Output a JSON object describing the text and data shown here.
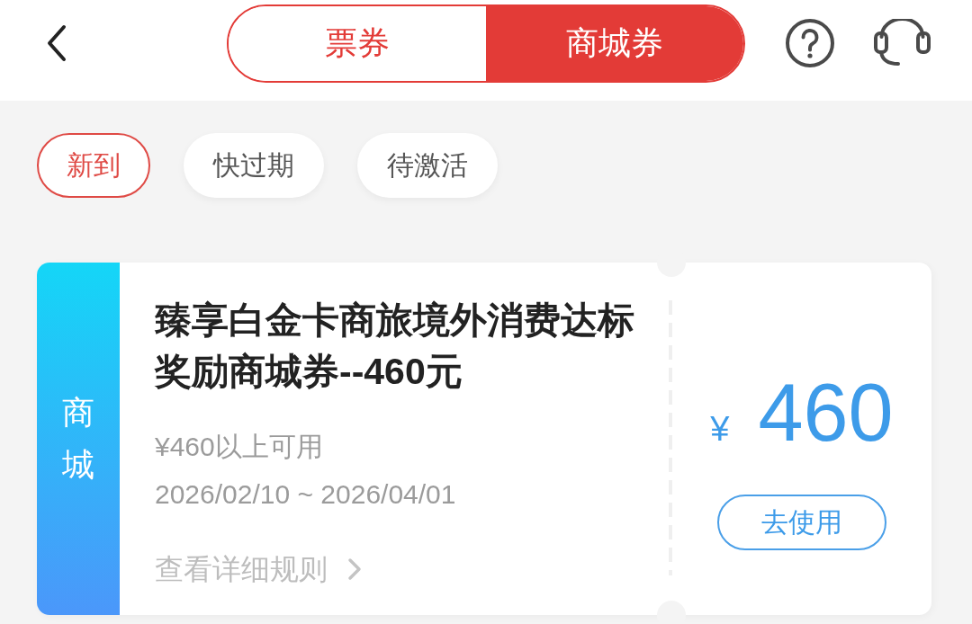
{
  "header": {
    "tabs": [
      {
        "label": "票券",
        "selected": false
      },
      {
        "label": "商城券",
        "selected": true
      }
    ]
  },
  "filters": [
    {
      "label": "新到",
      "selected": true
    },
    {
      "label": "快过期",
      "selected": false
    },
    {
      "label": "待激活",
      "selected": false
    }
  ],
  "coupons": [
    {
      "category": "商城",
      "title": "臻享白金卡商旅境外消费达标奖励商城券--460元",
      "condition": "¥460以上可用",
      "validity": "2026/02/10 ~ 2026/04/01",
      "rules_link": "查看详细规则",
      "currency": "¥",
      "amount": "460",
      "action": "去使用"
    }
  ]
}
